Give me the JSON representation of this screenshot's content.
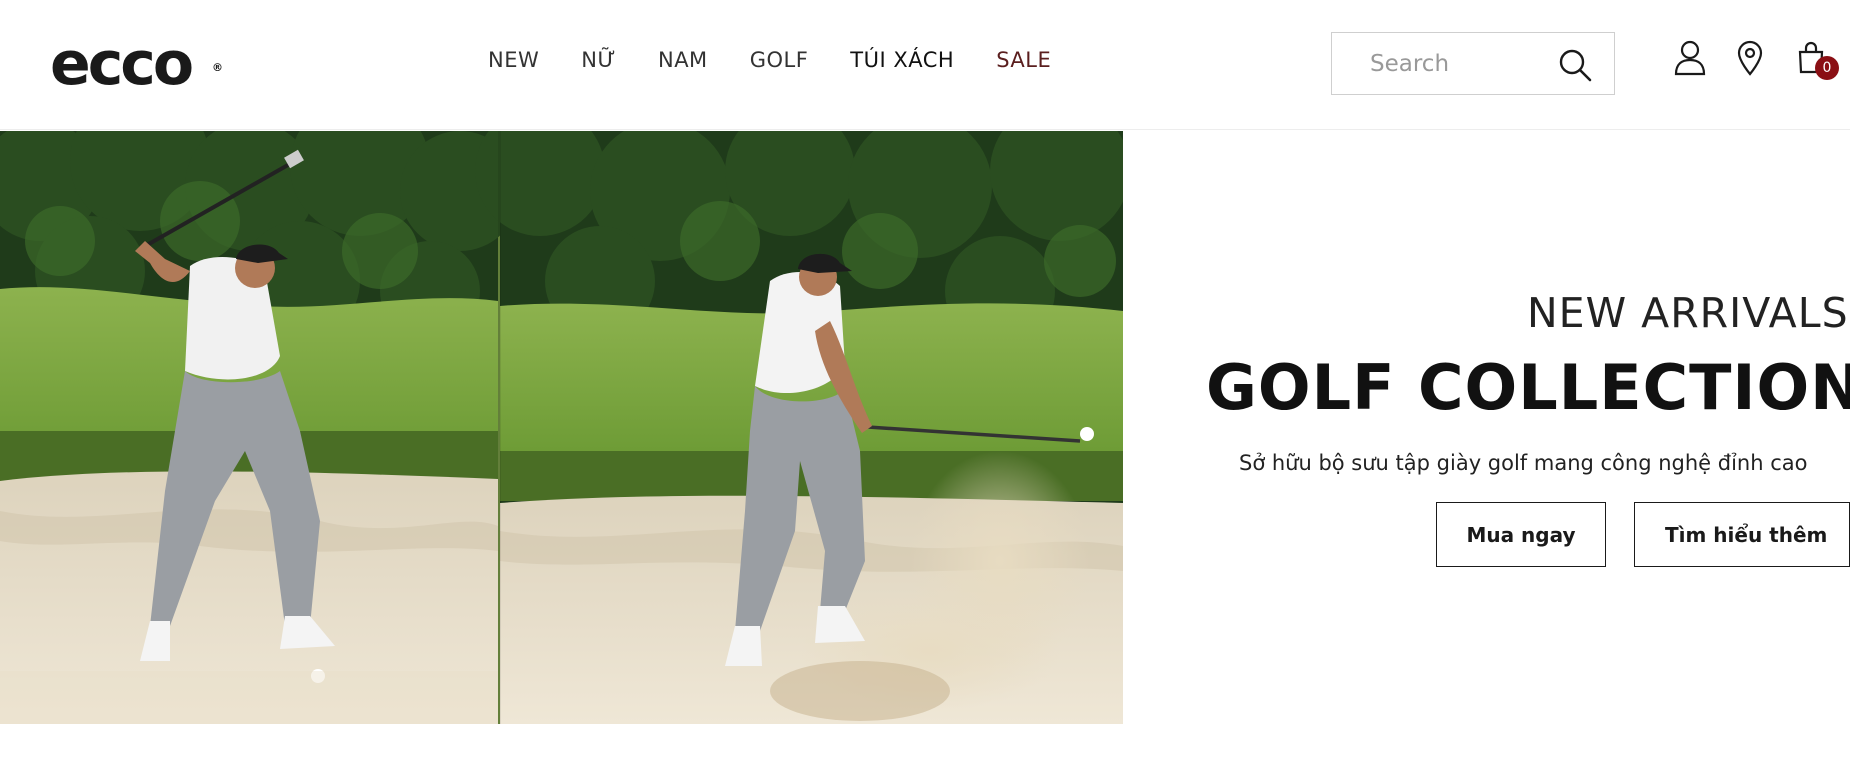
{
  "header": {
    "logo_text": "ecco",
    "logo_mark": "®",
    "nav": [
      {
        "label": "NEW"
      },
      {
        "label": "NỮ"
      },
      {
        "label": "NAM"
      },
      {
        "label": "GOLF"
      },
      {
        "label": "TÚI XÁCH"
      },
      {
        "label": "SALE"
      }
    ],
    "search": {
      "placeholder": "Search",
      "value": ""
    },
    "cart_count": "0",
    "icons": [
      "search-icon",
      "user-icon",
      "location-pin-icon",
      "shopping-bag-icon"
    ]
  },
  "hero": {
    "eyebrow": "NEW ARRIVALS",
    "headline": "GOLF COLLECTION",
    "subtext": "Sở hữu bộ sưu tập giày golf mang công nghệ đỉnh cao",
    "buttons": {
      "buy": "Mua ngay",
      "learn": "Tìm hiểu thêm"
    }
  },
  "colors": {
    "sale_nav": "#5a1e1e",
    "cart_badge": "#8a0f14",
    "text_dark": "#111111"
  }
}
